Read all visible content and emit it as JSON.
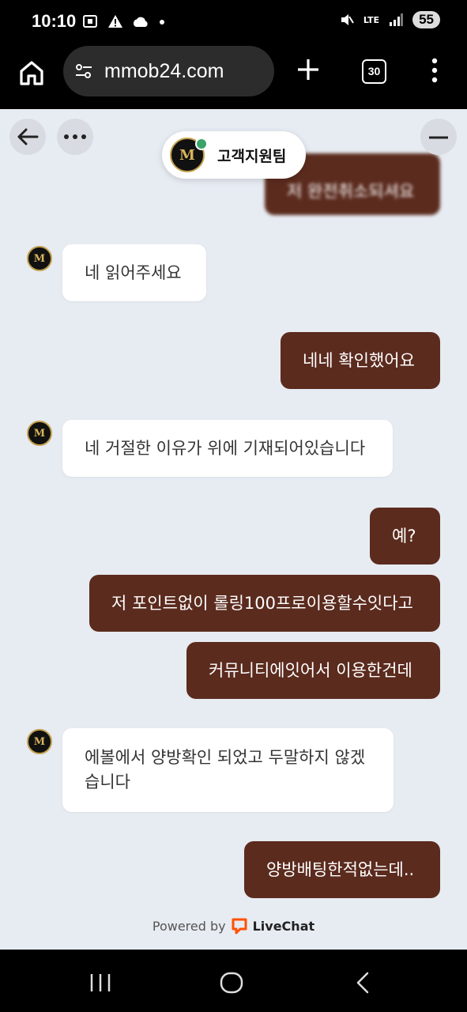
{
  "status_bar": {
    "time": "10:10",
    "battery": "55",
    "network": "LTE"
  },
  "browser": {
    "url": "mmob24.com",
    "tab_count": "30"
  },
  "chat_header": {
    "agent_name": "고객지원팀",
    "agent_logo": "M"
  },
  "messages": [
    {
      "side": "out",
      "text": "저 완전취소되셔요"
    },
    {
      "side": "in",
      "text": "네 읽어주세요"
    },
    {
      "side": "out",
      "text": "네네 확인했어요"
    },
    {
      "side": "in",
      "text": "네 거절한 이유가 위에 기재되어있습니다"
    },
    {
      "side": "out",
      "text": "예?"
    },
    {
      "side": "out",
      "text": "저 포인트없이 롤링100프로이용할수잇다고"
    },
    {
      "side": "out",
      "text": "커뮤니티에잇어서 이용한건데"
    },
    {
      "side": "in",
      "text": "에볼에서 양방확인 되었고 두말하지 않겠습니다"
    },
    {
      "side": "out",
      "text": "양방배팅한적없는데.."
    }
  ],
  "footer": {
    "powered_by": "Powered by",
    "brand": "LiveChat"
  },
  "colors": {
    "outgoing_bubble": "#5b2b1e",
    "chat_background": "#e7ebf2",
    "online": "#3aa36a"
  }
}
